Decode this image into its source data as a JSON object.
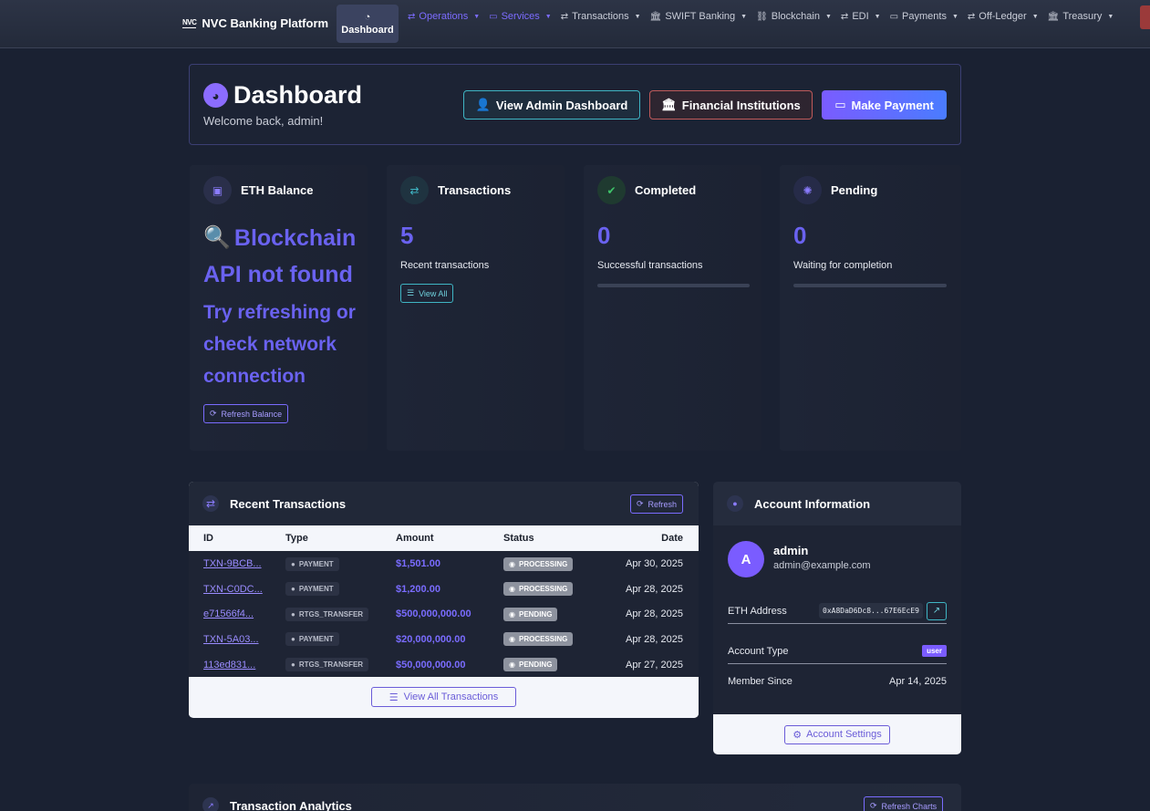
{
  "nav": {
    "brand_logo": "NVC",
    "brand": "NVC Banking Platform",
    "dashboard": "Dashboard",
    "items": [
      {
        "label": "Operations",
        "icon": "exchange-icon",
        "active": true
      },
      {
        "label": "Services",
        "icon": "card-icon",
        "active": true
      },
      {
        "label": "Transactions",
        "icon": "exchange-icon",
        "active": false
      },
      {
        "label": "SWIFT Banking",
        "icon": "bank-icon",
        "active": false
      },
      {
        "label": "Blockchain",
        "icon": "link-icon",
        "active": false
      },
      {
        "label": "EDI",
        "icon": "exchange-icon",
        "active": false
      },
      {
        "label": "Payments",
        "icon": "card-icon",
        "active": false
      },
      {
        "label": "Off-Ledger",
        "icon": "exchange-icon",
        "active": false
      },
      {
        "label": "Treasury",
        "icon": "bank-icon",
        "active": false
      }
    ]
  },
  "header": {
    "title": "Dashboard",
    "welcome": "Welcome back, admin!",
    "admin_btn": "View Admin Dashboard",
    "fi_btn": "Financial Institutions",
    "pay_btn": "Make Payment"
  },
  "stats": {
    "eth": {
      "label": "ETH Balance",
      "err_line1": "Blockchain",
      "err_line2": "API not found",
      "err_line3": "Try refreshing or check network connection",
      "refresh": "Refresh Balance"
    },
    "tx": {
      "label": "Transactions",
      "value": "5",
      "sub": "Recent transactions",
      "btn": "View All"
    },
    "completed": {
      "label": "Completed",
      "value": "0",
      "sub": "Successful transactions",
      "progress": 0
    },
    "pending": {
      "label": "Pending",
      "value": "0",
      "sub": "Waiting for completion",
      "progress": 0
    }
  },
  "recent": {
    "title": "Recent Transactions",
    "refresh": "Refresh",
    "columns": [
      "ID",
      "Type",
      "Amount",
      "Status",
      "Date"
    ],
    "rows": [
      {
        "id": "TXN-9BCB...",
        "type": "PAYMENT",
        "amount": "$1,501.00",
        "status": "PROCESSING",
        "date": "Apr 30, 2025"
      },
      {
        "id": "TXN-C0DC...",
        "type": "PAYMENT",
        "amount": "$1,200.00",
        "status": "PROCESSING",
        "date": "Apr 28, 2025"
      },
      {
        "id": "e71566f4...",
        "type": "RTGS_TRANSFER",
        "amount": "$500,000,000.00",
        "status": "PENDING",
        "date": "Apr 28, 2025"
      },
      {
        "id": "TXN-5A03...",
        "type": "PAYMENT",
        "amount": "$20,000,000.00",
        "status": "PROCESSING",
        "date": "Apr 28, 2025"
      },
      {
        "id": "113ed831...",
        "type": "RTGS_TRANSFER",
        "amount": "$50,000,000.00",
        "status": "PENDING",
        "date": "Apr 27, 2025"
      }
    ],
    "view_all": "View All Transactions"
  },
  "account": {
    "title": "Account Information",
    "avatar": "A",
    "name": "admin",
    "email": "admin@example.com",
    "eth_label": "ETH Address",
    "eth_address": "0xA8DaD6Dc8...67E6EcE9",
    "type_label": "Account Type",
    "type_value": "user",
    "since_label": "Member Since",
    "since_value": "Apr 14, 2025",
    "settings": "Account Settings"
  },
  "analytics": {
    "title": "Transaction Analytics",
    "refresh": "Refresh Charts"
  },
  "colors": {
    "accent": "#7a5cff",
    "page_bg": "#1a2132",
    "cyan": "#3fb5c4",
    "danger": "#c05a5a"
  }
}
